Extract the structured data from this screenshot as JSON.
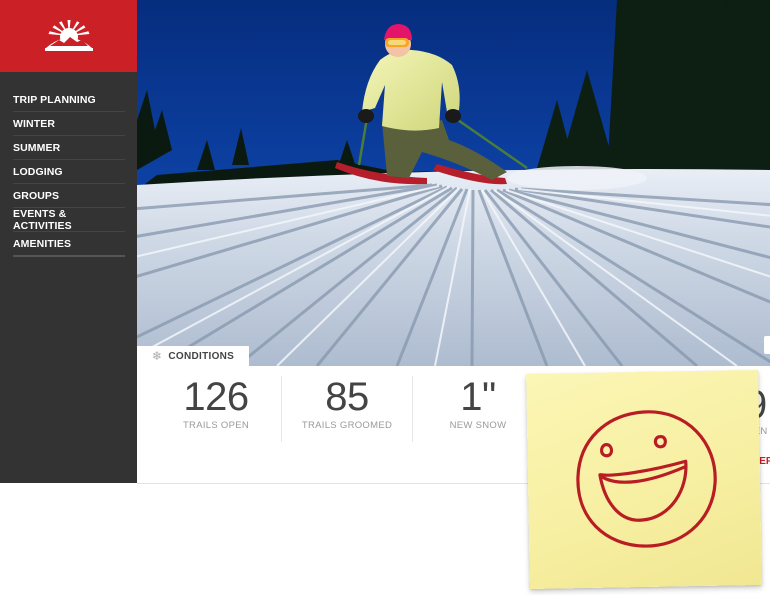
{
  "sidebar": {
    "logo_icon": "mountain-sun-logo-icon",
    "items": [
      {
        "label": "TRIP PLANNING"
      },
      {
        "label": "WINTER"
      },
      {
        "label": "SUMMER"
      },
      {
        "label": "LODGING"
      },
      {
        "label": "GROUPS"
      },
      {
        "label": "EVENTS & ACTIVITIES"
      },
      {
        "label": "AMENITIES"
      }
    ]
  },
  "hero": {
    "image": "skier-on-groomed-slope-photo"
  },
  "conditions": {
    "tab_label": "CONDITIONS",
    "tab_icon": "snowflake-icon",
    "stats": [
      {
        "value": "126",
        "label": "TRAILS OPEN"
      },
      {
        "value": "85",
        "label": "TRAILS GROOMED"
      },
      {
        "value": "1\"",
        "label": "NEW SNOW"
      }
    ],
    "partial_value": "9",
    "partial_label": "EN",
    "partial_link": "REP"
  },
  "sticky_note": {
    "drawing": "smiley-face-icon"
  },
  "colors": {
    "brand_red": "#cc2027",
    "sidebar_bg": "#333333",
    "sticky_yellow": "#f7efa2"
  }
}
